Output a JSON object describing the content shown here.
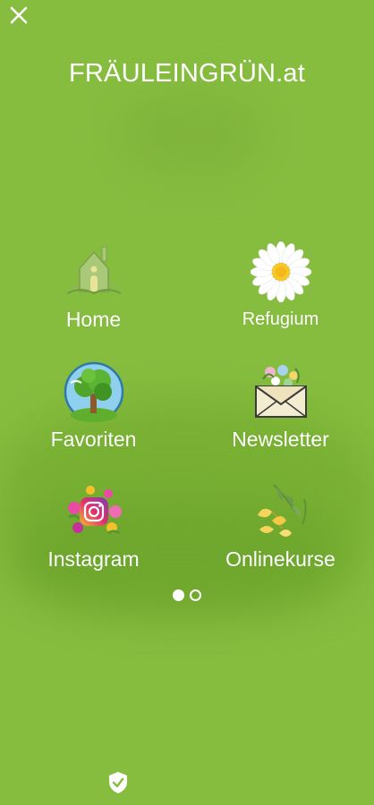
{
  "app": {
    "title": "FRÄULEINGRÜN.at",
    "background": "#86bd3f"
  },
  "header": {
    "close_icon": "close-icon"
  },
  "menu": {
    "items": [
      {
        "label": "Home",
        "icon": "house-icon"
      },
      {
        "label": "Refugium",
        "icon": "daisy-icon"
      },
      {
        "label": "Favoriten",
        "icon": "tree-globe-icon"
      },
      {
        "label": "Newsletter",
        "icon": "flower-envelope-icon"
      },
      {
        "label": "Instagram",
        "icon": "instagram-flowers-icon"
      },
      {
        "label": "Onlinekurse",
        "icon": "ginkgo-leaves-icon"
      }
    ]
  },
  "pagination": {
    "current": 1,
    "total": 2
  },
  "footer": {
    "icon": "shield-check-icon"
  }
}
